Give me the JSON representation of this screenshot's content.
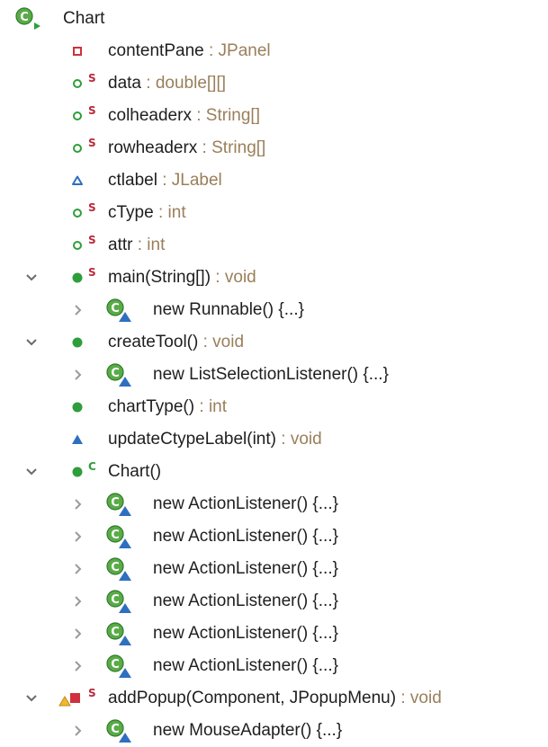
{
  "class_node": {
    "label": "Chart"
  },
  "members": [
    {
      "name": "contentPane",
      "sep": " : ",
      "type": "JPanel"
    },
    {
      "name": "data",
      "sep": " : ",
      "type": "double[][]"
    },
    {
      "name": "colheaderx",
      "sep": " : ",
      "type": "String[]"
    },
    {
      "name": "rowheaderx",
      "sep": " : ",
      "type": "String[]"
    },
    {
      "name": "ctlabel",
      "sep": " : ",
      "type": "JLabel"
    },
    {
      "name": "cType",
      "sep": " : ",
      "type": "int"
    },
    {
      "name": "attr",
      "sep": " : ",
      "type": "int"
    },
    {
      "name": "main(String[])",
      "sep": " : ",
      "type": "void"
    },
    {
      "name": "new Runnable() {...}"
    },
    {
      "name": "createTool()",
      "sep": " : ",
      "type": "void"
    },
    {
      "name": "new ListSelectionListener() {...}"
    },
    {
      "name": "chartType()",
      "sep": " : ",
      "type": "int"
    },
    {
      "name": "updateCtypeLabel(int)",
      "sep": " : ",
      "type": "void"
    },
    {
      "name": "Chart()"
    },
    {
      "name": "new ActionListener() {...}"
    },
    {
      "name": "new ActionListener() {...}"
    },
    {
      "name": "new ActionListener() {...}"
    },
    {
      "name": "new ActionListener() {...}"
    },
    {
      "name": "new ActionListener() {...}"
    },
    {
      "name": "new ActionListener() {...}"
    },
    {
      "name": "addPopup(Component, JPopupMenu)",
      "sep": " : ",
      "type": "void"
    },
    {
      "name": "new MouseAdapter() {...}"
    }
  ],
  "modifiers": {
    "static": "S",
    "constructor": "C"
  },
  "colors": {
    "text": "#1e1e1e",
    "type_annotation": "#9a7f5a",
    "public_green": "#2e9e3a",
    "private_red": "#d0303c",
    "protected_yellow": "#f0b830",
    "default_blue": "#2f6fbf",
    "static_modifier": "#b8283c",
    "twisty": "#6a6a6a"
  }
}
